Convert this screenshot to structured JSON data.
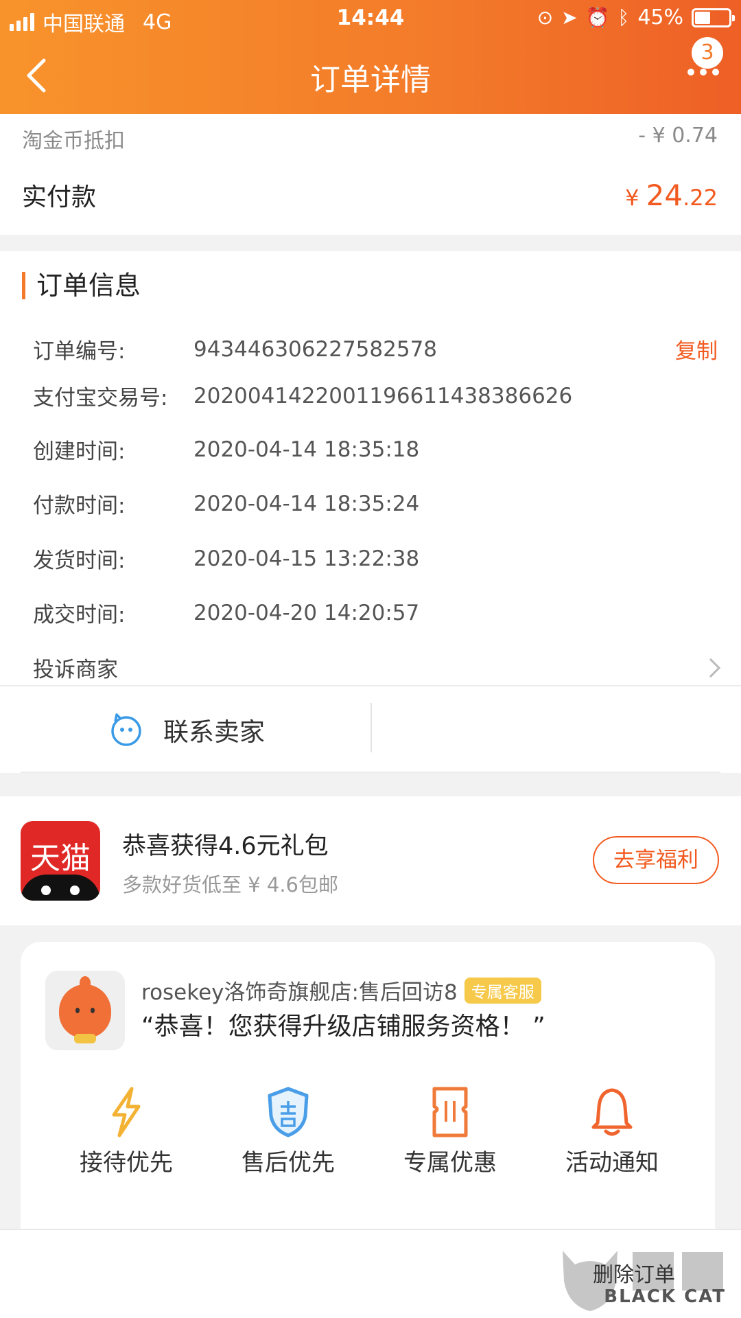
{
  "status_bar": {
    "carrier": "中国联通",
    "network": "4G",
    "time": "14:44",
    "battery": "45%"
  },
  "nav": {
    "title": "订单详情",
    "badge_count": "3"
  },
  "payment": {
    "coin_label": "淘金币抵扣",
    "coin_value": "- ¥ 0.74",
    "paid_label": "实付款",
    "currency": "¥",
    "paid_int": "24",
    "paid_dec": ".22"
  },
  "order_info": {
    "title": "订单信息",
    "copy_label": "复制",
    "rows": [
      {
        "label": "订单编号:",
        "value": "943446306227582578"
      },
      {
        "label": "支付宝交易号:",
        "value": "2020041422001196611438386626"
      },
      {
        "label": "创建时间:",
        "value": "2020-04-14 18:35:18"
      },
      {
        "label": "付款时间:",
        "value": "2020-04-14 18:35:24"
      },
      {
        "label": "发货时间:",
        "value": "2020-04-15 13:22:38"
      },
      {
        "label": "成交时间:",
        "value": "2020-04-20 14:20:57"
      }
    ],
    "complain_label": "投诉商家",
    "contact_label": "联系卖家"
  },
  "promo": {
    "logo_text": "天猫",
    "title": "恭喜获得4.6元礼包",
    "subtitle": "多款好货低至 ¥ 4.6包邮",
    "button": "去享福利"
  },
  "service_card": {
    "shop_name": "rosekey洛饰奇旗舰店:售后回访8",
    "tag": "专属客服",
    "quote": "“恭喜！您获得升级店铺服务资格！ ”",
    "items": [
      {
        "label": "接待优先",
        "icon": "lightning-icon",
        "color": "#f3b234"
      },
      {
        "label": "售后优先",
        "icon": "shield-icon",
        "color": "#4a9ee8"
      },
      {
        "label": "专属优惠",
        "icon": "coupon-icon",
        "color": "#f07a3a"
      },
      {
        "label": "活动通知",
        "icon": "bell-icon",
        "color": "#f0642e"
      }
    ]
  },
  "bottom": {
    "delete_label": "删除订单",
    "watermark_text": "BLACK CAT"
  },
  "colors": {
    "accent": "#f37a2a",
    "price": "#f25a1f"
  }
}
